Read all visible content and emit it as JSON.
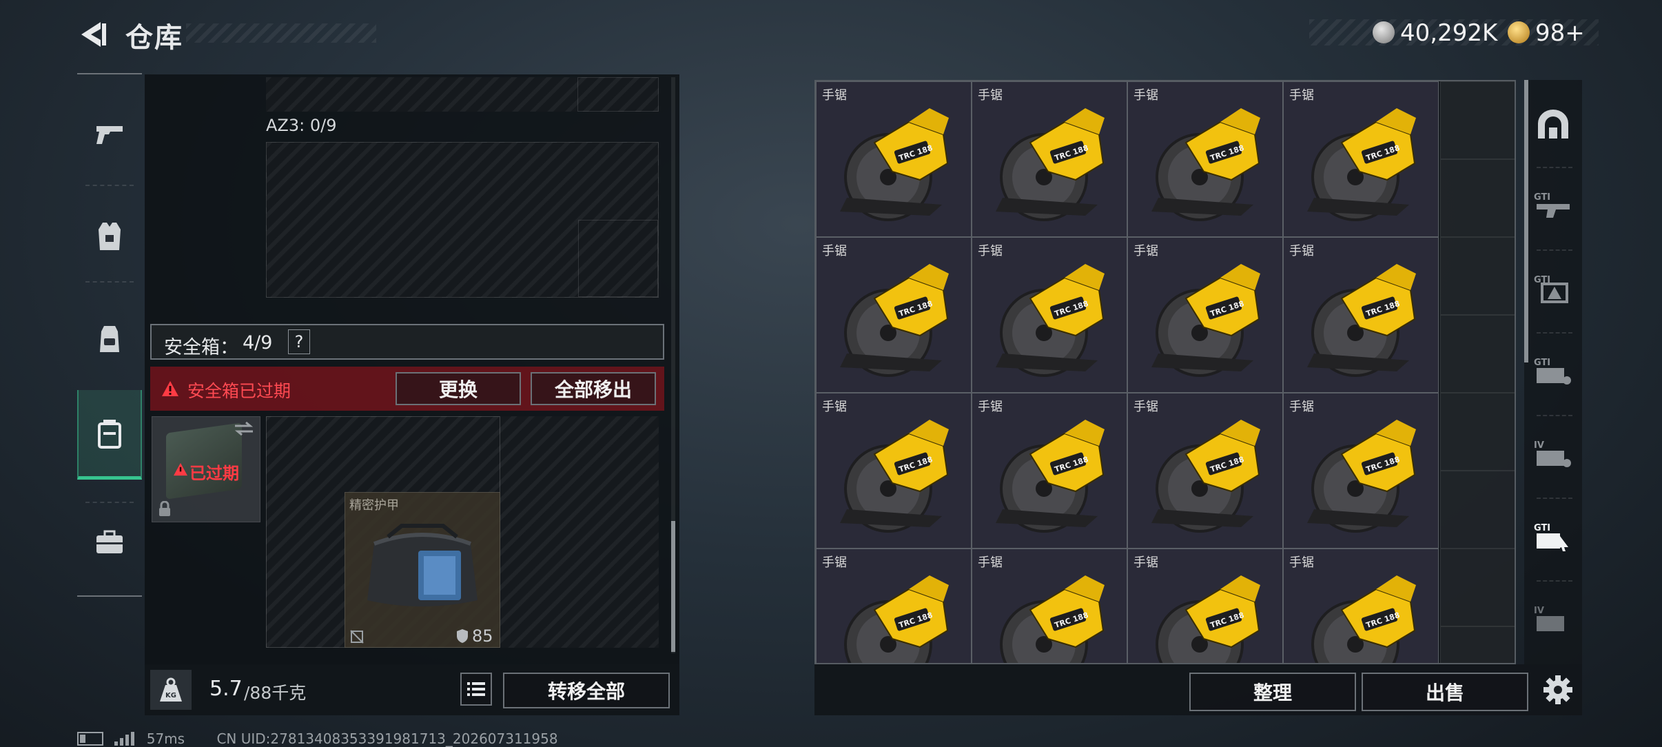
{
  "header": {
    "title": "仓库",
    "currency_1": "40,292K",
    "currency_2": "98+"
  },
  "left_nav": [
    {
      "name": "weapons"
    },
    {
      "name": "armor"
    },
    {
      "name": "backpack"
    },
    {
      "name": "safe-box"
    },
    {
      "name": "toolbox"
    }
  ],
  "container": {
    "az3_label": "AZ3: 0/9",
    "safe_label": "安全箱：",
    "safe_count": "4/9",
    "help": "?",
    "expired_warning": "安全箱已过期",
    "replace_button": "更换",
    "remove_all_button": "全部移出",
    "safe_item_badge": "已过期",
    "armor_item_name": "精密护甲",
    "armor_durability": "85"
  },
  "bottom_left": {
    "weight": "5.7",
    "weight_capacity": "/88千克",
    "transfer_all_button": "转移全部"
  },
  "warehouse": {
    "item_label": "手锯",
    "saw_brand": "TRC 188",
    "sort_button": "整理",
    "sell_button": "出售"
  },
  "right_nav": [
    "mine",
    "gti-1",
    "gti-2",
    "gti-3",
    "iv-1",
    "gti-4",
    "iv-2"
  ],
  "status": {
    "ping": "57ms",
    "uid": "CN UID:27813408353391981713_202607311958"
  },
  "colors": {
    "accent_green": "#37c48f",
    "danger_red": "#e0343c",
    "saw_yellow": "#f2c20f"
  }
}
